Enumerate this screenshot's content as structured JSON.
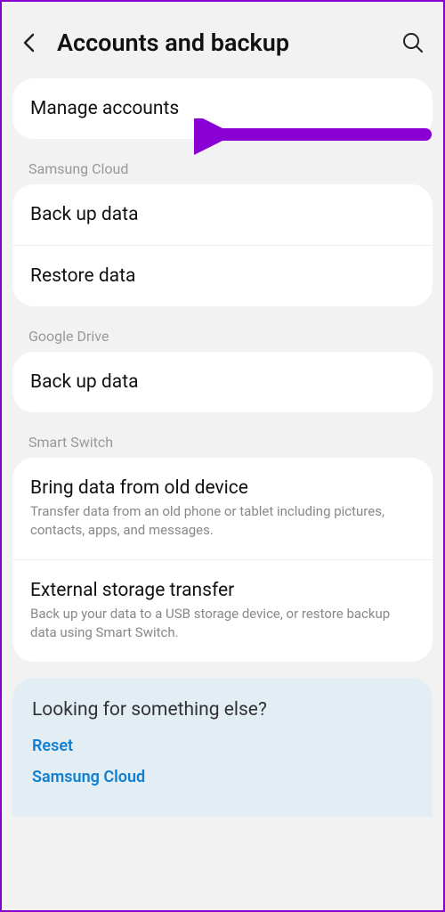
{
  "header": {
    "title": "Accounts and backup"
  },
  "manage_accounts": {
    "title": "Manage accounts"
  },
  "sections": {
    "samsung_cloud": {
      "label": "Samsung Cloud",
      "backup": "Back up data",
      "restore": "Restore data"
    },
    "google_drive": {
      "label": "Google Drive",
      "backup": "Back up data"
    },
    "smart_switch": {
      "label": "Smart Switch",
      "bring_title": "Bring data from old device",
      "bring_sub": "Transfer data from an old phone or tablet including pictures, contacts, apps, and messages.",
      "ext_title": "External storage transfer",
      "ext_sub": "Back up your data to a USB storage device, or restore backup data using Smart Switch."
    }
  },
  "footer": {
    "title": "Looking for something else?",
    "link1": "Reset",
    "link2": "Samsung Cloud"
  },
  "annotation": {
    "arrow_color": "#8a00d4"
  }
}
